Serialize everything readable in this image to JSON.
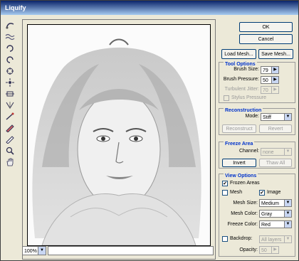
{
  "window": {
    "title": "Liquify"
  },
  "toolbar": {
    "tools": [
      "forward-warp",
      "turbulence",
      "twirl-clockwise",
      "twirl-counterclockwise",
      "pucker",
      "bloat",
      "shift-pixels",
      "reflection",
      "reconstruct",
      "freeze",
      "thaw",
      "zoom",
      "hand"
    ]
  },
  "buttons": {
    "ok": "OK",
    "cancel": "Cancel",
    "load_mesh": "Load Mesh...",
    "save_mesh": "Save Mesh..."
  },
  "tool_options": {
    "title": "Tool Options",
    "brush_size_label": "Brush Size:",
    "brush_size": "79",
    "brush_pressure_label": "Brush Pressure:",
    "brush_pressure": "50",
    "turbulent_jitter_label": "Turbulent Jitter:",
    "turbulent_jitter": "70",
    "stylus_pressure_label": "Stylus Pressure"
  },
  "reconstruction": {
    "title": "Reconstruction",
    "mode_label": "Mode:",
    "mode": "Stiff",
    "reconstruct": "Reconstruct",
    "revert": "Revert"
  },
  "freeze_area": {
    "title": "Freeze Area",
    "channel_label": "Channel:",
    "channel": "none",
    "invert": "Invert",
    "thaw_all": "Thaw All"
  },
  "view_options": {
    "title": "View Options",
    "frozen_areas": "Frozen Areas",
    "mesh": "Mesh",
    "image": "Image",
    "mesh_size_label": "Mesh Size:",
    "mesh_size": "Medium",
    "mesh_color_label": "Mesh Color:",
    "mesh_color": "Gray",
    "freeze_color_label": "Freeze Color:",
    "freeze_color": "Red",
    "backdrop": "Backdrop:",
    "backdrop_value": "All layers",
    "opacity_label": "Opacity:",
    "opacity": "50"
  },
  "zoom": {
    "value": "100%"
  }
}
